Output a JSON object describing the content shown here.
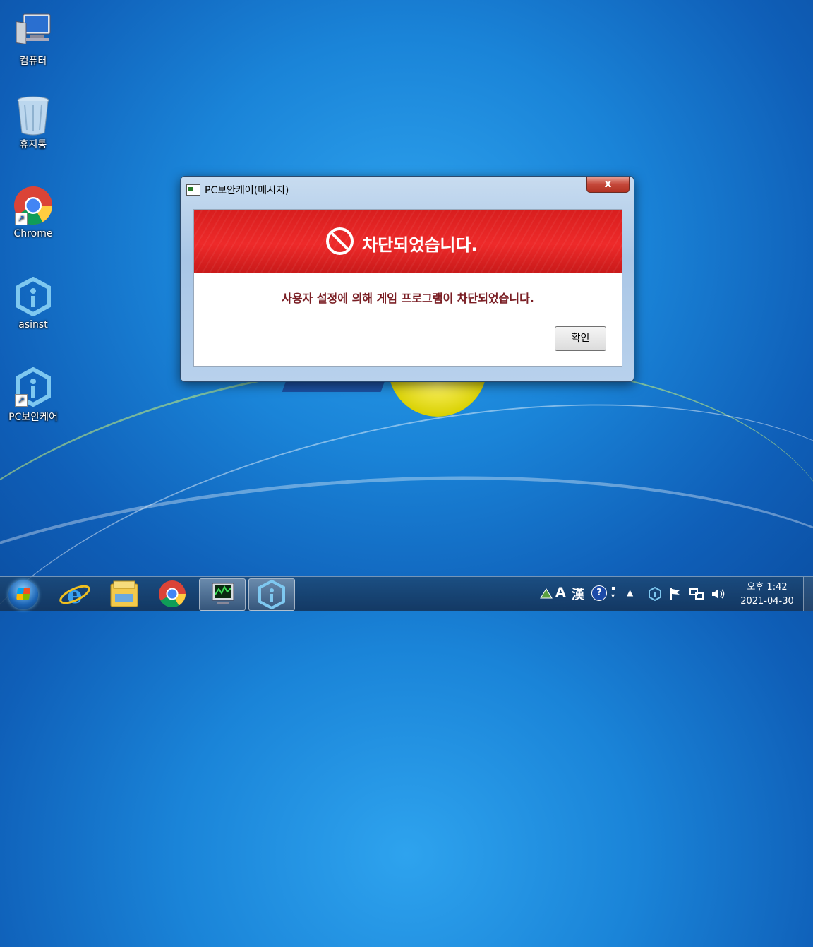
{
  "desktop": {
    "icons": [
      {
        "label": "컴퓨터"
      },
      {
        "label": "휴지통"
      },
      {
        "label": "Chrome"
      },
      {
        "label": "asinst"
      },
      {
        "label": "PC보안케어"
      }
    ]
  },
  "dialog": {
    "title": "PC보안케어(메시지)",
    "close_label": "x",
    "banner_title": "차단되었습니다.",
    "message": "사용자 설정에 의해 게임 프로그램이 차단되었습니다.",
    "ok_label": "확인",
    "banner_color": "#e52424",
    "message_color": "#7a1e24"
  },
  "taskbar": {
    "pinned": [
      "start-icon",
      "internet-explorer-icon",
      "file-explorer-icon",
      "chrome-icon",
      "task-manager-icon",
      "pc-security-care-icon"
    ],
    "tray": {
      "ime_a": "A",
      "ime_han": "漢",
      "ime_help": "?"
    },
    "clock": {
      "time": "오후 1:42",
      "date": "2021-04-30"
    }
  }
}
